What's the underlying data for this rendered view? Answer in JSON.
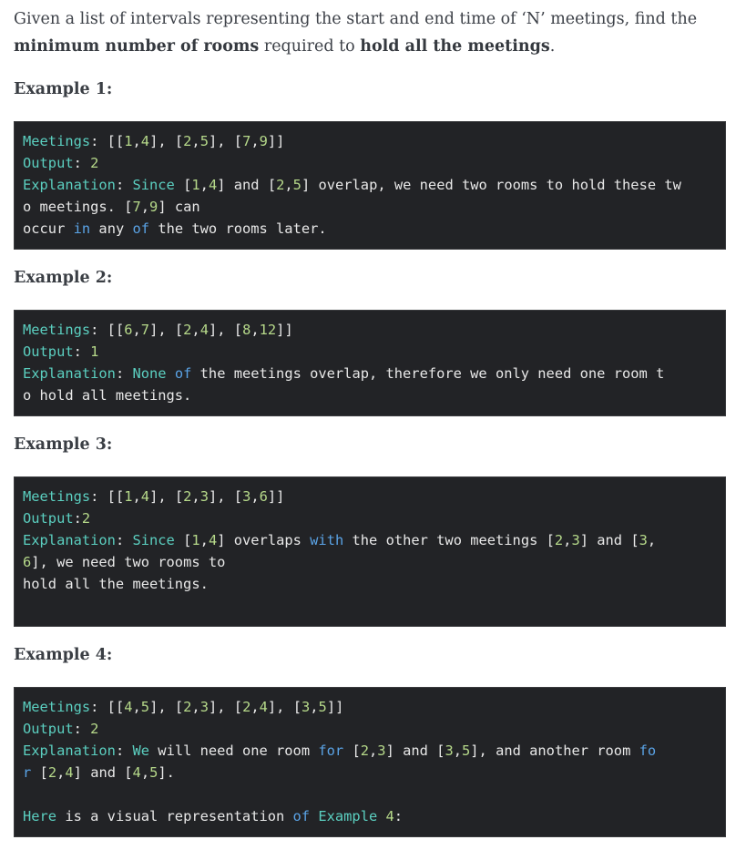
{
  "intro": {
    "p1": "Given a list of intervals representing the start and end time of ‘N’ meetings, find the ",
    "b1": "minimum number of rooms",
    "p2": " required to ",
    "b2": "hold all the meetings",
    "p3": "."
  },
  "examples": [
    {
      "heading": "Example 1:",
      "lines": [
        [
          [
            "Meetings",
            "t"
          ],
          [
            ": [[",
            ""
          ],
          [
            "1",
            "n"
          ],
          [
            ",",
            ""
          ],
          [
            "4",
            "n"
          ],
          [
            "], [",
            ""
          ],
          [
            "2",
            "n"
          ],
          [
            ",",
            ""
          ],
          [
            "5",
            "n"
          ],
          [
            "], [",
            ""
          ],
          [
            "7",
            "n"
          ],
          [
            ",",
            ""
          ],
          [
            "9",
            "n"
          ],
          [
            "]]",
            ""
          ]
        ],
        [
          [
            "Output",
            "t"
          ],
          [
            ": ",
            ""
          ],
          [
            "2",
            "n"
          ]
        ],
        [
          [
            "Explanation",
            "t"
          ],
          [
            ": ",
            ""
          ],
          [
            "Since",
            "t"
          ],
          [
            " [",
            ""
          ],
          [
            "1",
            "n"
          ],
          [
            ",",
            ""
          ],
          [
            "4",
            "n"
          ],
          [
            "] and [",
            ""
          ],
          [
            "2",
            "n"
          ],
          [
            ",",
            ""
          ],
          [
            "5",
            "n"
          ],
          [
            "] overlap, we need two rooms to hold these tw",
            ""
          ]
        ],
        [
          [
            "o meetings. [",
            ""
          ],
          [
            "7",
            "n"
          ],
          [
            ",",
            ""
          ],
          [
            "9",
            "n"
          ],
          [
            "] can",
            ""
          ]
        ],
        [
          [
            "occur ",
            ""
          ],
          [
            "in",
            "k"
          ],
          [
            " any ",
            ""
          ],
          [
            "of",
            "k"
          ],
          [
            " the two rooms later.",
            ""
          ]
        ]
      ]
    },
    {
      "heading": "Example 2:",
      "lines": [
        [
          [
            "Meetings",
            "t"
          ],
          [
            ": [[",
            ""
          ],
          [
            "6",
            "n"
          ],
          [
            ",",
            ""
          ],
          [
            "7",
            "n"
          ],
          [
            "], [",
            ""
          ],
          [
            "2",
            "n"
          ],
          [
            ",",
            ""
          ],
          [
            "4",
            "n"
          ],
          [
            "], [",
            ""
          ],
          [
            "8",
            "n"
          ],
          [
            ",",
            ""
          ],
          [
            "12",
            "n"
          ],
          [
            "]]",
            ""
          ]
        ],
        [
          [
            "Output",
            "t"
          ],
          [
            ": ",
            ""
          ],
          [
            "1",
            "n"
          ]
        ],
        [
          [
            "Explanation",
            "t"
          ],
          [
            ": ",
            ""
          ],
          [
            "None",
            "t"
          ],
          [
            " ",
            ""
          ],
          [
            "of",
            "k"
          ],
          [
            " the meetings overlap, therefore we only need one room t",
            ""
          ]
        ],
        [
          [
            "o hold all meetings.",
            ""
          ]
        ]
      ]
    },
    {
      "heading": "Example 3:",
      "lines": [
        [
          [
            "Meetings",
            "t"
          ],
          [
            ": [[",
            ""
          ],
          [
            "1",
            "n"
          ],
          [
            ",",
            ""
          ],
          [
            "4",
            "n"
          ],
          [
            "], [",
            ""
          ],
          [
            "2",
            "n"
          ],
          [
            ",",
            ""
          ],
          [
            "3",
            "n"
          ],
          [
            "], [",
            ""
          ],
          [
            "3",
            "n"
          ],
          [
            ",",
            ""
          ],
          [
            "6",
            "n"
          ],
          [
            "]]",
            ""
          ]
        ],
        [
          [
            "Output",
            "t"
          ],
          [
            ":",
            ""
          ],
          [
            "2",
            "n"
          ]
        ],
        [
          [
            "Explanation",
            "t"
          ],
          [
            ": ",
            ""
          ],
          [
            "Since",
            "t"
          ],
          [
            " [",
            ""
          ],
          [
            "1",
            "n"
          ],
          [
            ",",
            ""
          ],
          [
            "4",
            "n"
          ],
          [
            "] overlaps ",
            ""
          ],
          [
            "with",
            "k"
          ],
          [
            " the other two meetings [",
            ""
          ],
          [
            "2",
            "n"
          ],
          [
            ",",
            ""
          ],
          [
            "3",
            "n"
          ],
          [
            "] and [",
            ""
          ],
          [
            "3",
            "n"
          ],
          [
            ",",
            ""
          ]
        ],
        [
          [
            "6",
            "n"
          ],
          [
            "], we need two rooms to",
            ""
          ]
        ],
        [
          [
            "hold all the meetings.",
            ""
          ]
        ]
      ]
    },
    {
      "heading": "Example 4:",
      "lines": [
        [
          [
            "Meetings",
            "t"
          ],
          [
            ": [[",
            ""
          ],
          [
            "4",
            "n"
          ],
          [
            ",",
            ""
          ],
          [
            "5",
            "n"
          ],
          [
            "], [",
            ""
          ],
          [
            "2",
            "n"
          ],
          [
            ",",
            ""
          ],
          [
            "3",
            "n"
          ],
          [
            "], [",
            ""
          ],
          [
            "2",
            "n"
          ],
          [
            ",",
            ""
          ],
          [
            "4",
            "n"
          ],
          [
            "], [",
            ""
          ],
          [
            "3",
            "n"
          ],
          [
            ",",
            ""
          ],
          [
            "5",
            "n"
          ],
          [
            "]]",
            ""
          ]
        ],
        [
          [
            "Output",
            "t"
          ],
          [
            ": ",
            ""
          ],
          [
            "2",
            "n"
          ]
        ],
        [
          [
            "Explanation",
            "t"
          ],
          [
            ": ",
            ""
          ],
          [
            "We",
            "t"
          ],
          [
            " will need one room ",
            ""
          ],
          [
            "for",
            "k"
          ],
          [
            " [",
            ""
          ],
          [
            "2",
            "n"
          ],
          [
            ",",
            ""
          ],
          [
            "3",
            "n"
          ],
          [
            "] and [",
            ""
          ],
          [
            "3",
            "n"
          ],
          [
            ",",
            ""
          ],
          [
            "5",
            "n"
          ],
          [
            "], and another room ",
            ""
          ],
          [
            "fo",
            "k"
          ]
        ],
        [
          [
            "r",
            "k"
          ],
          [
            " [",
            ""
          ],
          [
            "2",
            "n"
          ],
          [
            ",",
            ""
          ],
          [
            "4",
            "n"
          ],
          [
            "] and [",
            ""
          ],
          [
            "4",
            "n"
          ],
          [
            ",",
            ""
          ],
          [
            "5",
            "n"
          ],
          [
            "].",
            ""
          ]
        ],
        [
          [
            "",
            ""
          ]
        ],
        [
          [
            "Here",
            "t"
          ],
          [
            " is a visual representation ",
            ""
          ],
          [
            "of",
            "k"
          ],
          [
            " ",
            ""
          ],
          [
            "Example",
            "t"
          ],
          [
            " ",
            ""
          ],
          [
            "4",
            "n"
          ],
          [
            ":",
            ""
          ]
        ]
      ]
    }
  ]
}
